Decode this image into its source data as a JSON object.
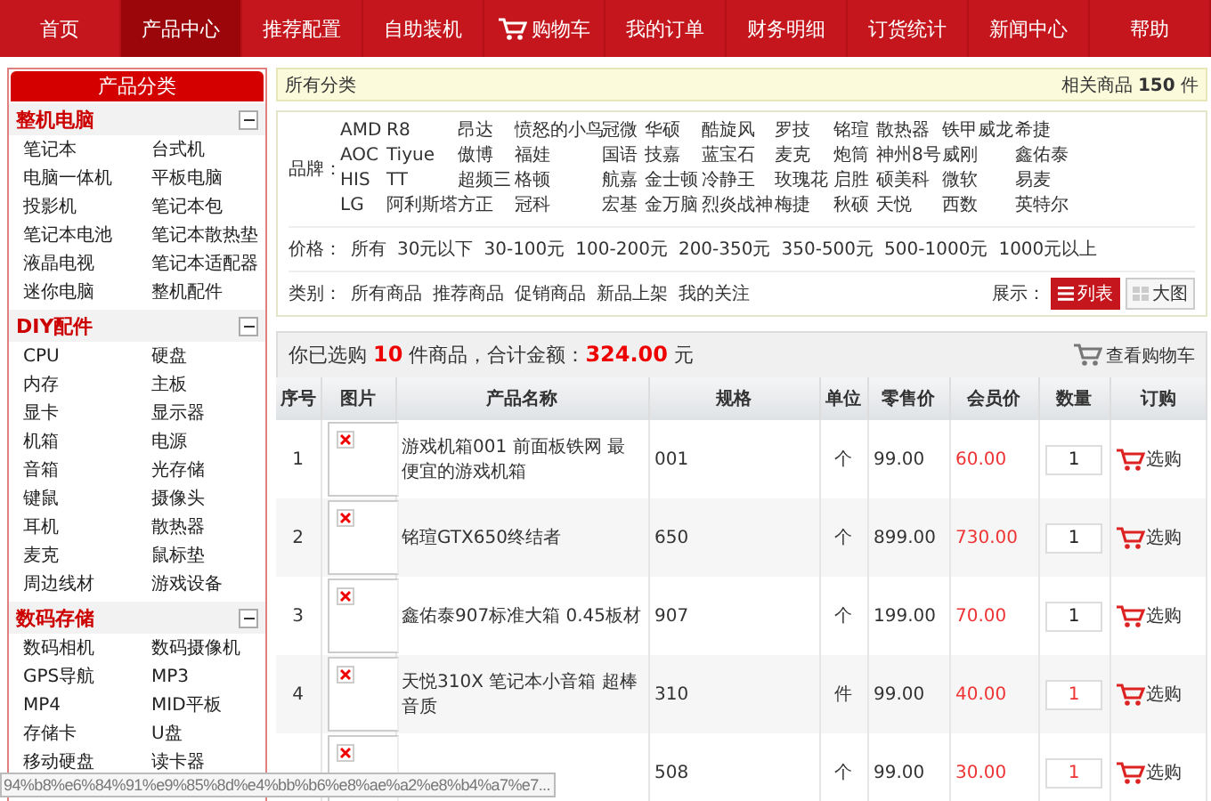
{
  "nav": [
    {
      "label": "首页",
      "selected": false
    },
    {
      "label": "产品中心",
      "selected": true
    },
    {
      "label": "推荐配置",
      "selected": false
    },
    {
      "label": "自助装机",
      "selected": false
    },
    {
      "label": "购物车",
      "selected": false,
      "kind": "cart"
    },
    {
      "label": "我的订单",
      "selected": false
    },
    {
      "label": "财务明细",
      "selected": false
    },
    {
      "label": "订货统计",
      "selected": false
    },
    {
      "label": "新闻中心",
      "selected": false
    },
    {
      "label": "帮助",
      "selected": false
    }
  ],
  "sidebar": {
    "title": "产品分类",
    "groups": [
      {
        "title": "整机电脑",
        "expanded": true,
        "items": [
          "笔记本",
          "台式机",
          "电脑一体机",
          "平板电脑",
          "投影机",
          "笔记本包",
          "笔记本电池",
          "笔记本散热垫",
          "液晶电视",
          "笔记本适配器",
          "迷你电脑",
          "整机配件"
        ]
      },
      {
        "title": "DIY配件",
        "expanded": true,
        "items": [
          "CPU",
          "硬盘",
          "内存",
          "主板",
          "显卡",
          "显示器",
          "机箱",
          "电源",
          "音箱",
          "光存储",
          "键鼠",
          "摄像头",
          "耳机",
          "散热器",
          "麦克",
          "鼠标垫",
          "周边线材",
          "游戏设备"
        ]
      },
      {
        "title": "数码存储",
        "expanded": true,
        "items": [
          "数码相机",
          "数码摄像机",
          "GPS导航",
          "MP3",
          "MP4",
          "MID平板",
          "存储卡",
          "U盘",
          "移动硬盘",
          "读卡器"
        ]
      }
    ]
  },
  "breadcrumb": "所有分类",
  "count": {
    "prefix": "相关商品",
    "value": "150",
    "suffix": "件"
  },
  "filters": {
    "brand_label": "品牌：",
    "brands": [
      [
        "AMD",
        "R8",
        "昂达",
        "愤怒的小鸟",
        "冠微",
        "华硕",
        "酷旋风",
        "罗技",
        "铭瑄",
        "散热器",
        "铁甲威龙",
        "希捷"
      ],
      [
        "AOC",
        "Tiyue",
        "傲博",
        "福娃",
        "国语",
        "技嘉",
        "蓝宝石",
        "麦克",
        "炮筒",
        "神州8号",
        "威刚",
        "鑫佑泰"
      ],
      [
        "HIS",
        "TT",
        "超频三",
        "格顿",
        "航嘉",
        "金士顿",
        "冷静王",
        "玫瑰花",
        "启胜",
        "硕美科",
        "微软",
        "易麦"
      ],
      [
        "LG",
        "阿利斯塔",
        "方正",
        "冠科",
        "宏基",
        "金万脑",
        "烈炎战神",
        "梅捷",
        "秋硕",
        "天悦",
        "西数",
        "英特尔"
      ]
    ],
    "price_label": "价格：",
    "prices": [
      "所有",
      "30元以下",
      "30-100元",
      "100-200元",
      "200-350元",
      "350-500元",
      "500-1000元",
      "1000元以上"
    ],
    "category_label": "类别：",
    "categories": [
      "所有商品",
      "推荐商品",
      "促销商品",
      "新品上架",
      "我的关注"
    ],
    "view_label": "展示：",
    "views": [
      {
        "label": "列表",
        "kind": "list",
        "selected": true
      },
      {
        "label": "大图",
        "kind": "grid",
        "selected": false
      }
    ]
  },
  "summary": {
    "t1": "你已选购",
    "count": "10",
    "t2": "件商品，合计金额：",
    "amount": "324.00",
    "t3": "元",
    "cart_link": "查看购物车"
  },
  "table": {
    "columns": [
      "序号",
      "图片",
      "产品名称",
      "规格",
      "单位",
      "零售价",
      "会员价",
      "数量",
      "订购"
    ],
    "rows": [
      {
        "seq": "1",
        "name": "游戏机箱001 前面板铁网 最便宜的游戏机箱",
        "spec": "001",
        "unit": "个",
        "retail": "99.00",
        "member": "60.00",
        "qty": "1",
        "qty_highlight": false,
        "order": "选购"
      },
      {
        "seq": "2",
        "name": "铭瑄GTX650终结者",
        "spec": "650",
        "unit": "个",
        "retail": "899.00",
        "member": "730.00",
        "qty": "1",
        "qty_highlight": false,
        "order": "选购"
      },
      {
        "seq": "3",
        "name": "鑫佑泰907标准大箱 0.45板材",
        "spec": "907",
        "unit": "个",
        "retail": "199.00",
        "member": "70.00",
        "qty": "1",
        "qty_highlight": false,
        "order": "选购"
      },
      {
        "seq": "4",
        "name": "天悦310X 笔记本小音箱 超棒音质",
        "spec": "310",
        "unit": "件",
        "retail": "99.00",
        "member": "40.00",
        "qty": "1",
        "qty_highlight": true,
        "order": "选购"
      },
      {
        "spec": "508",
        "unit": "个",
        "retail": "99.00",
        "member": "30.00",
        "qty": "1",
        "qty_highlight": true,
        "order": "选购"
      }
    ]
  },
  "status_url": "94%b8%e6%84%91%e9%85%8d%e4%bb%b6%e8%ae%a2%e8%b4%a7%e7..."
}
